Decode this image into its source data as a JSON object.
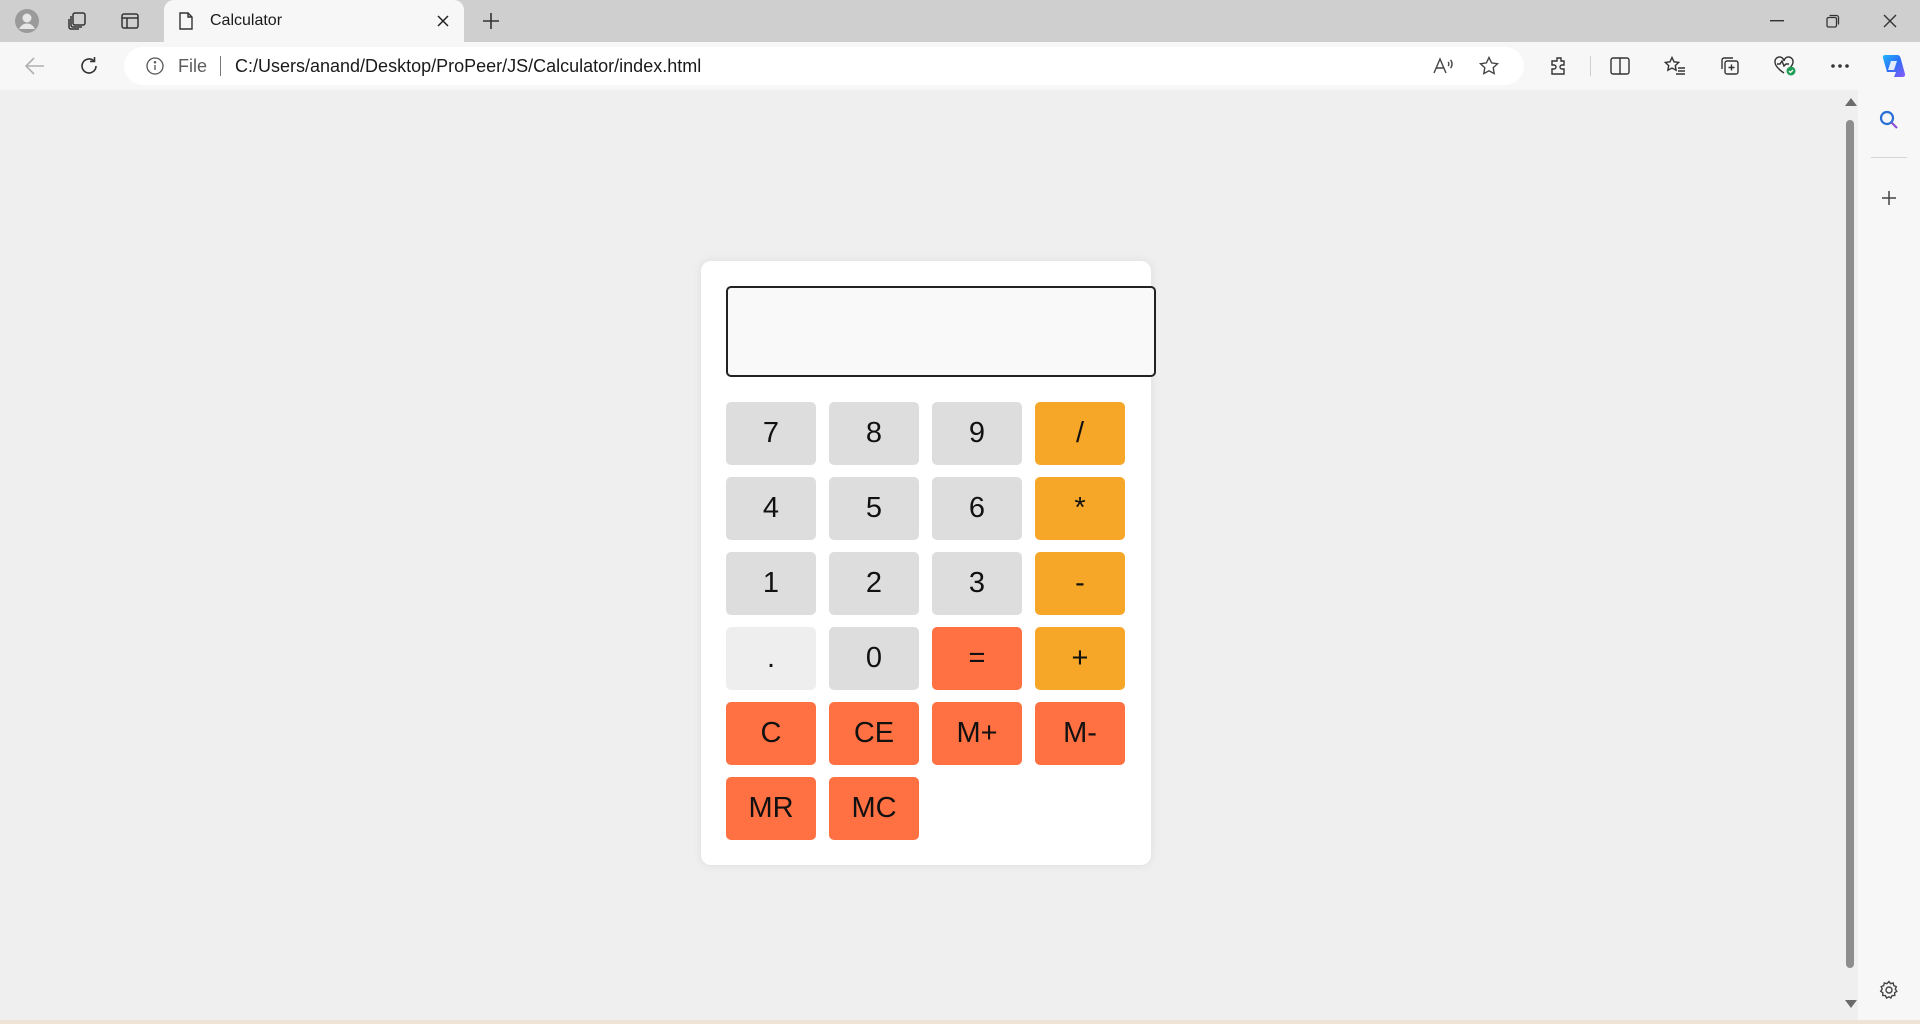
{
  "browser": {
    "tab_title": "Calculator",
    "address": {
      "scheme_label": "File",
      "url": "C:/Users/anand/Desktop/ProPeer/JS/Calculator/index.html"
    }
  },
  "calculator": {
    "display_value": "",
    "rows": [
      [
        {
          "label": "7",
          "kind": "num"
        },
        {
          "label": "8",
          "kind": "num"
        },
        {
          "label": "9",
          "kind": "num"
        },
        {
          "label": "/",
          "kind": "op"
        }
      ],
      [
        {
          "label": "4",
          "kind": "num"
        },
        {
          "label": "5",
          "kind": "num"
        },
        {
          "label": "6",
          "kind": "num"
        },
        {
          "label": "*",
          "kind": "op"
        }
      ],
      [
        {
          "label": "1",
          "kind": "num"
        },
        {
          "label": "2",
          "kind": "num"
        },
        {
          "label": "3",
          "kind": "num"
        },
        {
          "label": "-",
          "kind": "op"
        }
      ],
      [
        {
          "label": ".",
          "kind": "dot"
        },
        {
          "label": "0",
          "kind": "num"
        },
        {
          "label": "=",
          "kind": "fn"
        },
        {
          "label": "+",
          "kind": "op"
        }
      ],
      [
        {
          "label": "C",
          "kind": "fn"
        },
        {
          "label": "CE",
          "kind": "fn"
        },
        {
          "label": "M+",
          "kind": "fn"
        },
        {
          "label": "M-",
          "kind": "fn"
        }
      ],
      [
        {
          "label": "MR",
          "kind": "fn"
        },
        {
          "label": "MC",
          "kind": "fn"
        }
      ]
    ]
  },
  "colors": {
    "number_key": "#dddddd",
    "dot_key": "#eeeeee",
    "operator_key": "#f7a728",
    "function_key": "#ff7043",
    "page_background": "#efefef"
  },
  "icons": {
    "tabstrip": [
      "profile-icon",
      "workspaces-icon",
      "tab-actions-icon",
      "page-icon",
      "close-icon",
      "new-tab-icon",
      "minimize-icon",
      "restore-icon",
      "close-window-icon"
    ],
    "toolbar": [
      "back-icon",
      "refresh-icon",
      "info-icon",
      "read-aloud-icon",
      "favorite-star-icon",
      "extensions-icon",
      "split-screen-icon",
      "favorites-icon",
      "collections-icon",
      "browser-essentials-icon",
      "more-icon",
      "copilot-icon"
    ],
    "sidebar": [
      "search-icon",
      "add-icon",
      "settings-icon"
    ]
  }
}
